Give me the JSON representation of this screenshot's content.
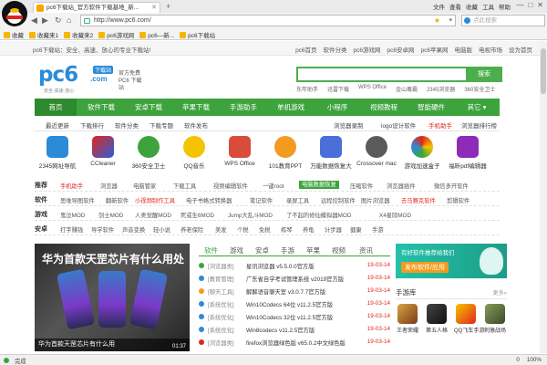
{
  "browser": {
    "tab_title": "pc6下载站_官方软件下载基地_新...",
    "new_tab": "+",
    "menu": [
      "文件",
      "查看",
      "收藏",
      "工具",
      "帮助"
    ],
    "window_controls": [
      "—",
      "□",
      "✕"
    ],
    "back": "◀",
    "forward": "▶",
    "refresh": "↻",
    "home": "⌂",
    "url": "http://www.pc6.com/",
    "search_placeholder": "点此搜索",
    "bookmarks": [
      "收藏",
      "收藏来1",
      "收藏来2",
      "pc6游戏网",
      "pc6—新...",
      "pc6下载站"
    ]
  },
  "page": {
    "topstrip": {
      "slogan": "pc6下载站：安全、高速、放心的专业下载站!",
      "links": [
        "pc6首页",
        "软件分类",
        "pc6游戏网",
        "pc6安卓网",
        "pc6苹果网",
        "电脑版",
        "电视市场",
        "设为首页"
      ]
    },
    "logo": {
      "text": "pc6",
      "dotcom": ".com",
      "badge": "下载站",
      "tagline": "安全·高速·放心",
      "side": "官方免费 PC6 下载站"
    },
    "search": {
      "button": "搜索",
      "hotwords": [
        "东年助手",
        "迅雷下载",
        "WPS Office",
        "金山毒霸",
        "2345浏览器",
        "360安全卫士"
      ]
    },
    "main_nav": [
      "首页",
      "软件下载",
      "安卓下载",
      "苹果下载",
      "手游助手",
      "单机游戏",
      "小程序",
      "视频教程",
      "智能硬件",
      "其它 ▾"
    ],
    "sub_nav": [
      "最近更新",
      "下载排行",
      "软件分类",
      "下载专题",
      "软件发布",
      "浏览器录制",
      "logo设计软件",
      "手机助手",
      "浏览器排行榜"
    ],
    "apps": [
      "2345网址导航",
      "CCleaner",
      "360安全卫士",
      "QQ音乐",
      "WPS Office",
      "101教育PPT",
      "万能数据恢复大",
      "Crossover mac",
      "游戏加速盒子",
      "福昕pdf编辑器"
    ],
    "cat_rows": [
      {
        "label": "推荐",
        "items": [
          "手机助手",
          "浏览器",
          "电脑管家",
          "下载工具",
          "视频编辑软件",
          "一键root",
          "电脑数据恢复",
          "压缩软件",
          "浏览器插件",
          "微信多开软件"
        ]
      },
      {
        "label": "软件",
        "items": [
          "思维导图软件",
          "翻新软件",
          "小视频制作工具",
          "电子书格式转换器",
          "笔记软件",
          "录屏工具",
          "远程控制软件",
          "图片浏览器",
          "去马赛克软件",
          "剪辑软件"
        ]
      },
      {
        "label": "游戏",
        "items": [
          "鬼泣MOD",
          "剑士MOD",
          "人类觉醒MOD",
          "死或生6MOD",
          "Jump大乱斗MOD",
          "了不起的修仙模拟器MOD",
          "X4星际MOD"
        ]
      },
      {
        "label": "安卓",
        "items": [
          "打字赚钱",
          "导学软件",
          "声音变换",
          "轻小说",
          "养老保险",
          "美发",
          "个税",
          "免税",
          "练琴",
          "养龟",
          "计步器",
          "健康",
          "手游"
        ]
      }
    ],
    "feature": {
      "headline": "华为首款天罡芯片有什么用处",
      "caption": "华为首款天罡芯片有什么用",
      "time": "01:37"
    },
    "news_tabs": [
      "软件",
      "游戏",
      "安卓",
      "手游",
      "苹果",
      "视频",
      "资讯"
    ],
    "news": [
      {
        "cat": "[浏览器类]",
        "title": "星讯浏览器 v5.5.0.0官方版",
        "date": "19-03-14"
      },
      {
        "cat": "[教育管理]",
        "title": "广东省自学考试管理系统 v2019官方版",
        "date": "19-03-14"
      },
      {
        "cat": "[聊天工具]",
        "title": "解解语音聊天室 v3.0.7.7官方版",
        "date": "19-03-14"
      },
      {
        "cat": "[系统优化]",
        "title": "Win10Codecs 64位 v11.2.5官方版",
        "date": "19-03-14"
      },
      {
        "cat": "[系统优化]",
        "title": "Win10Codecs 32位 v11.2.5官方版",
        "date": "19-03-14"
      },
      {
        "cat": "[系统优化]",
        "title": "Win8codecs v11.2.5官方版",
        "date": "19-03-14"
      },
      {
        "cat": "[浏览器类]",
        "title": "firefox浏览器绿色版 v65.0.2中文绿色版",
        "date": "19-03-14"
      }
    ],
    "promo": {
      "line": "有好软件推荐给我们",
      "button": "发布软件/应用"
    },
    "game_lib": {
      "title": "手游库",
      "more": "更多»",
      "games": [
        "王者荣耀",
        "第五人格",
        "QQ飞车手游",
        "刺激战场"
      ]
    }
  },
  "status": {
    "text": "完成",
    "right": [
      "0",
      "100%"
    ]
  },
  "colors": {
    "brand_green": "#3da33d",
    "brand_blue": "#2b8bd9",
    "accent_red": "#e0261c"
  }
}
